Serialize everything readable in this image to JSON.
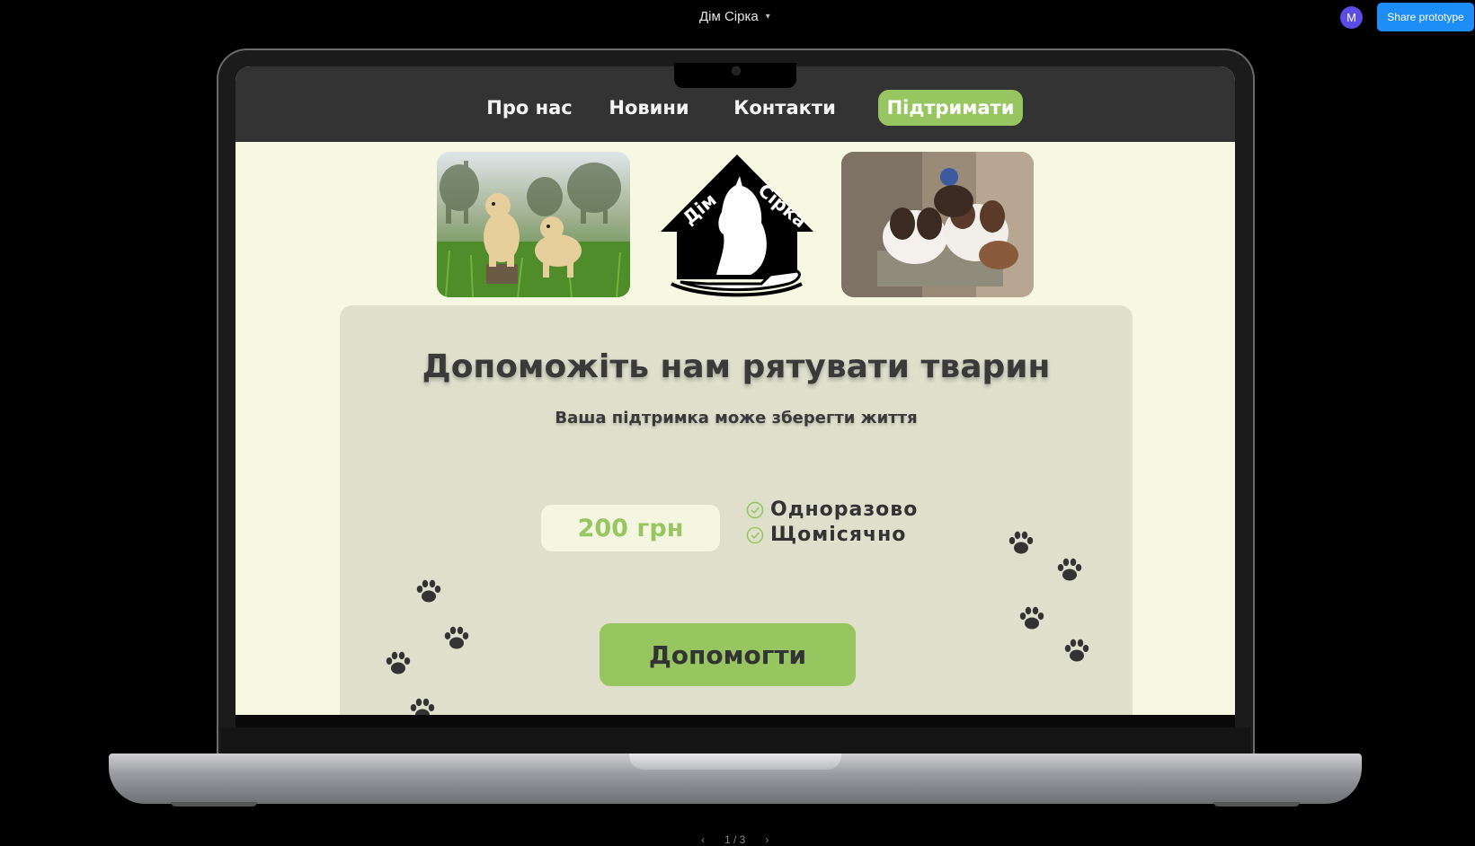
{
  "app": {
    "project_title": "Дім Сірка",
    "avatar_initial": "M",
    "share_label": "Share prototype",
    "pager": "1 / 3"
  },
  "site": {
    "nav": [
      {
        "label": "Про нас"
      },
      {
        "label": "Новини"
      },
      {
        "label": "Контакти"
      },
      {
        "label": "Підтримати",
        "active": true
      }
    ],
    "logo_text": "Дім Сірка",
    "heading": "Допоможіть нам рятувати тварин",
    "subheading": "Ваша підтримка може зберегти життя",
    "amount": "200 грн",
    "options": [
      "Одноразово",
      "Щомісячно"
    ],
    "cta": "Допомогти"
  },
  "colors": {
    "accent": "#97c661",
    "nav_bg": "#333333",
    "page_bg": "#f6f8e2",
    "card_bg": "#dee0cc",
    "share_btn": "#1e8df5"
  }
}
